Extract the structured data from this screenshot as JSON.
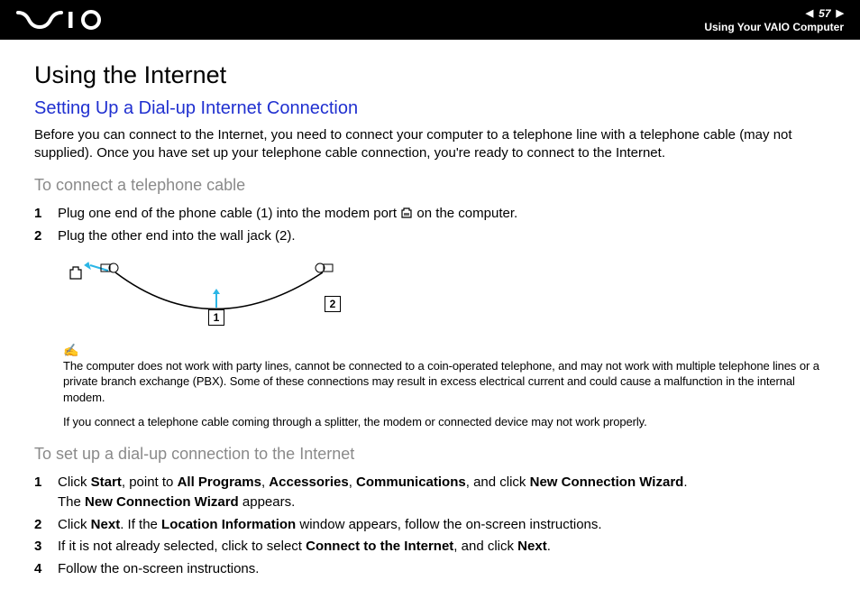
{
  "header": {
    "page_number": "57",
    "breadcrumb": "Using Your VAIO Computer"
  },
  "title": "Using the Internet",
  "subtitle": "Setting Up a Dial-up Internet Connection",
  "intro": "Before you can connect to the Internet, you need to connect your computer to a telephone line with a telephone cable (may not supplied). Once you have set up your telephone cable connection, you're ready to connect to the Internet.",
  "section1": {
    "heading": "To connect a telephone cable",
    "steps": [
      {
        "n": "1",
        "pre": "Plug one end of the phone cable (1) into the modem port ",
        "post": " on the computer."
      },
      {
        "n": "2",
        "text": "Plug the other end into the wall jack (2)."
      }
    ]
  },
  "diagram": {
    "label1": "1",
    "label2": "2"
  },
  "note1": "The computer does not work with party lines, cannot be connected to a coin-operated telephone, and may not work with multiple telephone lines or a private branch exchange (PBX). Some of these connections may result in excess electrical current and could cause a malfunction in the internal modem.",
  "note2": "If you connect a telephone cable coming through a splitter, the modem or connected device may not work properly.",
  "section2": {
    "heading": "To set up a dial-up connection to the Internet",
    "steps": [
      {
        "n": "1",
        "parts": [
          "Click ",
          "Start",
          ", point to ",
          "All Programs",
          ", ",
          "Accessories",
          ", ",
          "Communications",
          ", and click ",
          "New Connection Wizard",
          ".",
          "\nThe ",
          "New Connection Wizard",
          " appears."
        ]
      },
      {
        "n": "2",
        "parts": [
          "Click ",
          "Next",
          ". If the ",
          "Location Information",
          " window appears, follow the on-screen instructions."
        ]
      },
      {
        "n": "3",
        "parts": [
          "If it is not already selected, click to select ",
          "Connect to the Internet",
          ", and click ",
          "Next",
          "."
        ]
      },
      {
        "n": "4",
        "parts": [
          "Follow the on-screen instructions."
        ]
      }
    ]
  }
}
